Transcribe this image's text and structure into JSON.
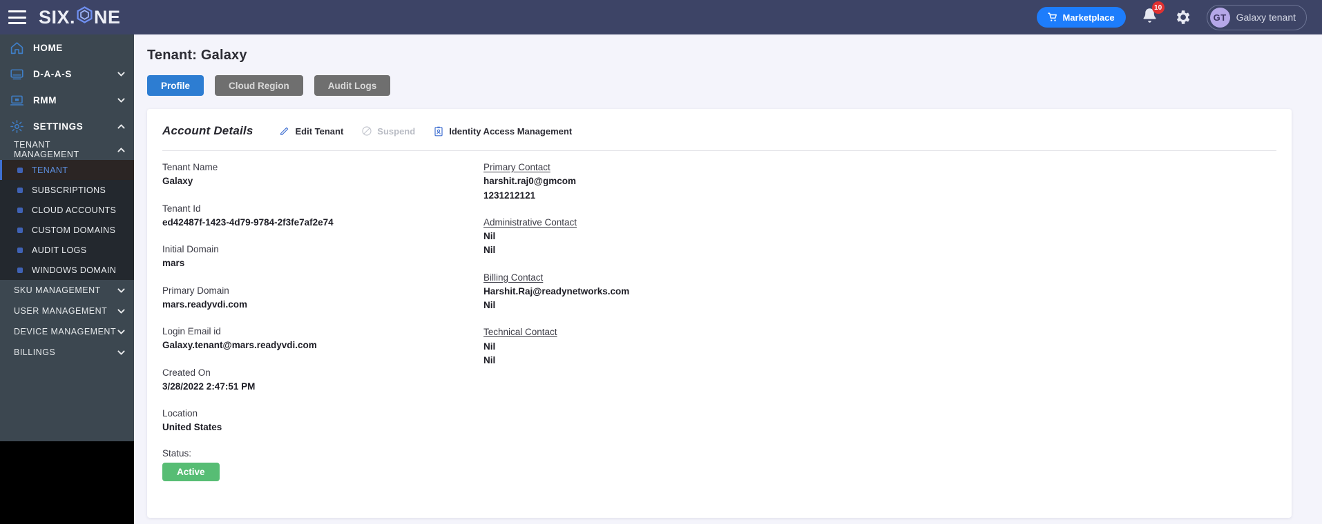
{
  "topbar": {
    "menu_icon": "hamburger-icon",
    "logo_part1": "SIX.",
    "logo_part2": "NE",
    "marketplace_label": "Marketplace",
    "cart_icon": "shopping-cart-icon",
    "bell_icon": "bell-icon",
    "notification_count": "10",
    "gear_icon": "gear-icon",
    "avatar_initials": "GT",
    "profile_name": "Galaxy tenant"
  },
  "sidebar": {
    "main_items": [
      {
        "label": "HOME",
        "icon": "home-icon",
        "chevron": "none"
      },
      {
        "label": "D-A-A-S",
        "icon": "monitor-icon",
        "chevron": "down"
      },
      {
        "label": "RMM",
        "icon": "laptop-icon",
        "chevron": "down"
      },
      {
        "label": "SETTINGS",
        "icon": "gear-icon",
        "chevron": "up"
      }
    ],
    "tenant_management_label": "TENANT MANAGEMENT",
    "tenant_management_chevron": "up",
    "tenant_items": [
      {
        "label": "TENANT",
        "active": true
      },
      {
        "label": "SUBSCRIPTIONS",
        "active": false
      },
      {
        "label": "CLOUD ACCOUNTS",
        "active": false
      },
      {
        "label": "CUSTOM DOMAINS",
        "active": false
      },
      {
        "label": "AUDIT LOGS",
        "active": false
      },
      {
        "label": "WINDOWS DOMAIN",
        "active": false
      }
    ],
    "groups": [
      {
        "label": "SKU MANAGEMENT",
        "chevron": "down"
      },
      {
        "label": "USER MANAGEMENT",
        "chevron": "down"
      },
      {
        "label": "DEVICE MANAGEMENT",
        "chevron": "down"
      },
      {
        "label": "BILLINGS",
        "chevron": "down"
      }
    ]
  },
  "main": {
    "page_title": "Tenant: Galaxy",
    "tabs": [
      {
        "label": "Profile",
        "active": true
      },
      {
        "label": "Cloud Region",
        "active": false
      },
      {
        "label": "Audit Logs",
        "active": false
      }
    ],
    "card": {
      "title": "Account Details",
      "actions": [
        {
          "label": "Edit Tenant",
          "icon": "pencil-icon",
          "disabled": false
        },
        {
          "label": "Suspend",
          "icon": "ban-icon",
          "disabled": true
        },
        {
          "label": "Identity Access Management",
          "icon": "id-badge-icon",
          "disabled": false
        }
      ],
      "left_fields": [
        {
          "label": "Tenant Name",
          "value": "Galaxy"
        },
        {
          "label": "Tenant Id",
          "value": "ed42487f-1423-4d79-9784-2f3fe7af2e74"
        },
        {
          "label": "Initial Domain",
          "value": "mars"
        },
        {
          "label": "Primary Domain",
          "value": "mars.readyvdi.com"
        },
        {
          "label": "Login Email id",
          "value": "Galaxy.tenant@mars.readyvdi.com"
        },
        {
          "label": "Created On",
          "value": "3/28/2022 2:47:51 PM"
        },
        {
          "label": "Location",
          "value": "United States"
        }
      ],
      "status_label": "Status:",
      "status_value": "Active",
      "right_fields": [
        {
          "label": "Primary Contact",
          "value1": "harshit.raj0@gmcom",
          "value2": "1231212121"
        },
        {
          "label": "Administrative Contact",
          "value1": "Nil",
          "value2": "Nil"
        },
        {
          "label": "Billing Contact",
          "value1": "Harshit.Raj@readynetworks.com",
          "value2": "Nil"
        },
        {
          "label": "Technical Contact",
          "value1": "Nil",
          "value2": "Nil"
        }
      ]
    }
  },
  "colors": {
    "topbar_bg": "#3d4466",
    "sidebar_bg": "#3c4750",
    "submenu_bg": "#23282e",
    "accent_blue": "#2d7dd2",
    "marketplace_blue": "#1d7dfc",
    "badge_red": "#e03131",
    "status_green": "#57bd74",
    "page_bg": "#f4f4fb"
  }
}
